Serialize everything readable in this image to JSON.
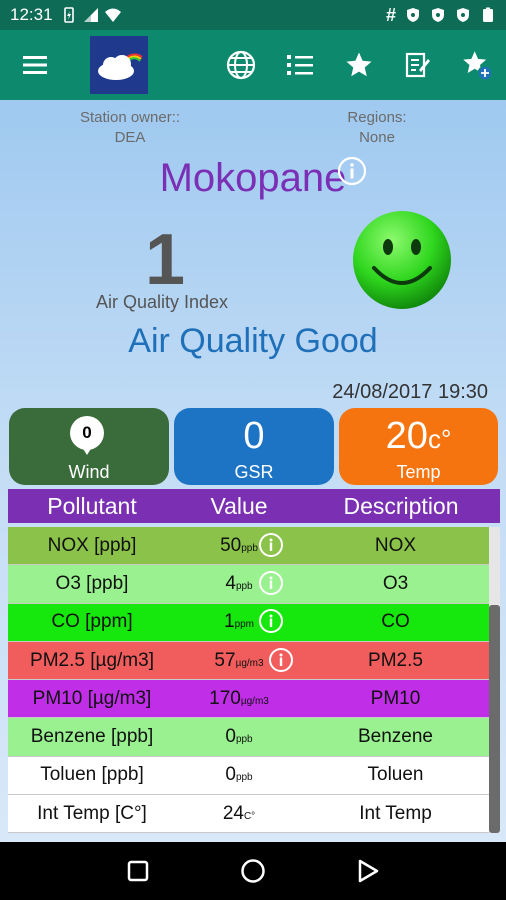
{
  "status_bar": {
    "time": "12:31",
    "left_icons": [
      "battery-saver-icon",
      "signal-icon",
      "wifi-icon"
    ],
    "right_icons": [
      "hash-icon",
      "shield-icon",
      "shield-icon",
      "shield-icon",
      "battery-icon"
    ]
  },
  "app_bar": {
    "menu_icon": "menu-icon",
    "logo_icon": "cloud-rainbow-logo-icon",
    "actions": [
      "globe-icon",
      "list-icon",
      "star-icon",
      "edit-note-icon",
      "star-add-icon"
    ]
  },
  "station": {
    "owner_label": "Station owner::",
    "owner_value": "DEA",
    "regions_label": "Regions:",
    "regions_value": "None",
    "name": "Mokopane"
  },
  "aqi": {
    "value": "1",
    "label": "Air Quality Index",
    "status": "Air Quality Good",
    "face": "smiley-face-icon"
  },
  "datetime": "24/08/2017 19:30",
  "tiles": {
    "wind": {
      "value": "0",
      "label": "Wind"
    },
    "gsr": {
      "value": "0",
      "label": "GSR"
    },
    "temp": {
      "value": "20",
      "unit": "c°",
      "label": "Temp"
    }
  },
  "table": {
    "headers": {
      "pollutant": "Pollutant",
      "value": "Value",
      "description": "Description"
    },
    "rows": [
      {
        "pollutant": "NOX [ppb]",
        "value": "50",
        "unit": "ppb",
        "description": "NOX",
        "color": "#8bc34a",
        "info": true
      },
      {
        "pollutant": "O3 [ppb]",
        "value": "4",
        "unit": "ppb",
        "description": "O3",
        "color": "#99f28f",
        "info": true
      },
      {
        "pollutant": "CO [ppm]",
        "value": "1",
        "unit": "ppm",
        "description": "CO",
        "color": "#16e80e",
        "info": true
      },
      {
        "pollutant": "PM2.5 [µg/m3]",
        "value": "57",
        "unit": "µg/m3",
        "description": "PM2.5",
        "color": "#f15c5c",
        "info": true
      },
      {
        "pollutant": "PM10 [µg/m3]",
        "value": "170",
        "unit": "µg/m3",
        "description": "PM10",
        "color": "#c02ee8",
        "info": false
      },
      {
        "pollutant": "Benzene [ppb]",
        "value": "0",
        "unit": "ppb",
        "description": "Benzene",
        "color": "#99f28f",
        "info": false
      },
      {
        "pollutant": "Toluen [ppb]",
        "value": "0",
        "unit": "ppb",
        "description": "Toluen",
        "color": "#ffffff",
        "info": false
      },
      {
        "pollutant": "Int Temp [C°]",
        "value": "24",
        "unit": "C°",
        "description": "Int Temp",
        "color": "#ffffff",
        "info": false
      }
    ]
  },
  "nav": [
    "recents-square-icon",
    "home-circle-icon",
    "back-triangle-icon"
  ],
  "colors": {
    "accent": "#0d8a6e",
    "station_name": "#7a2fb5",
    "status_text": "#1f70b8",
    "header_bg": "#7b2fb2"
  }
}
